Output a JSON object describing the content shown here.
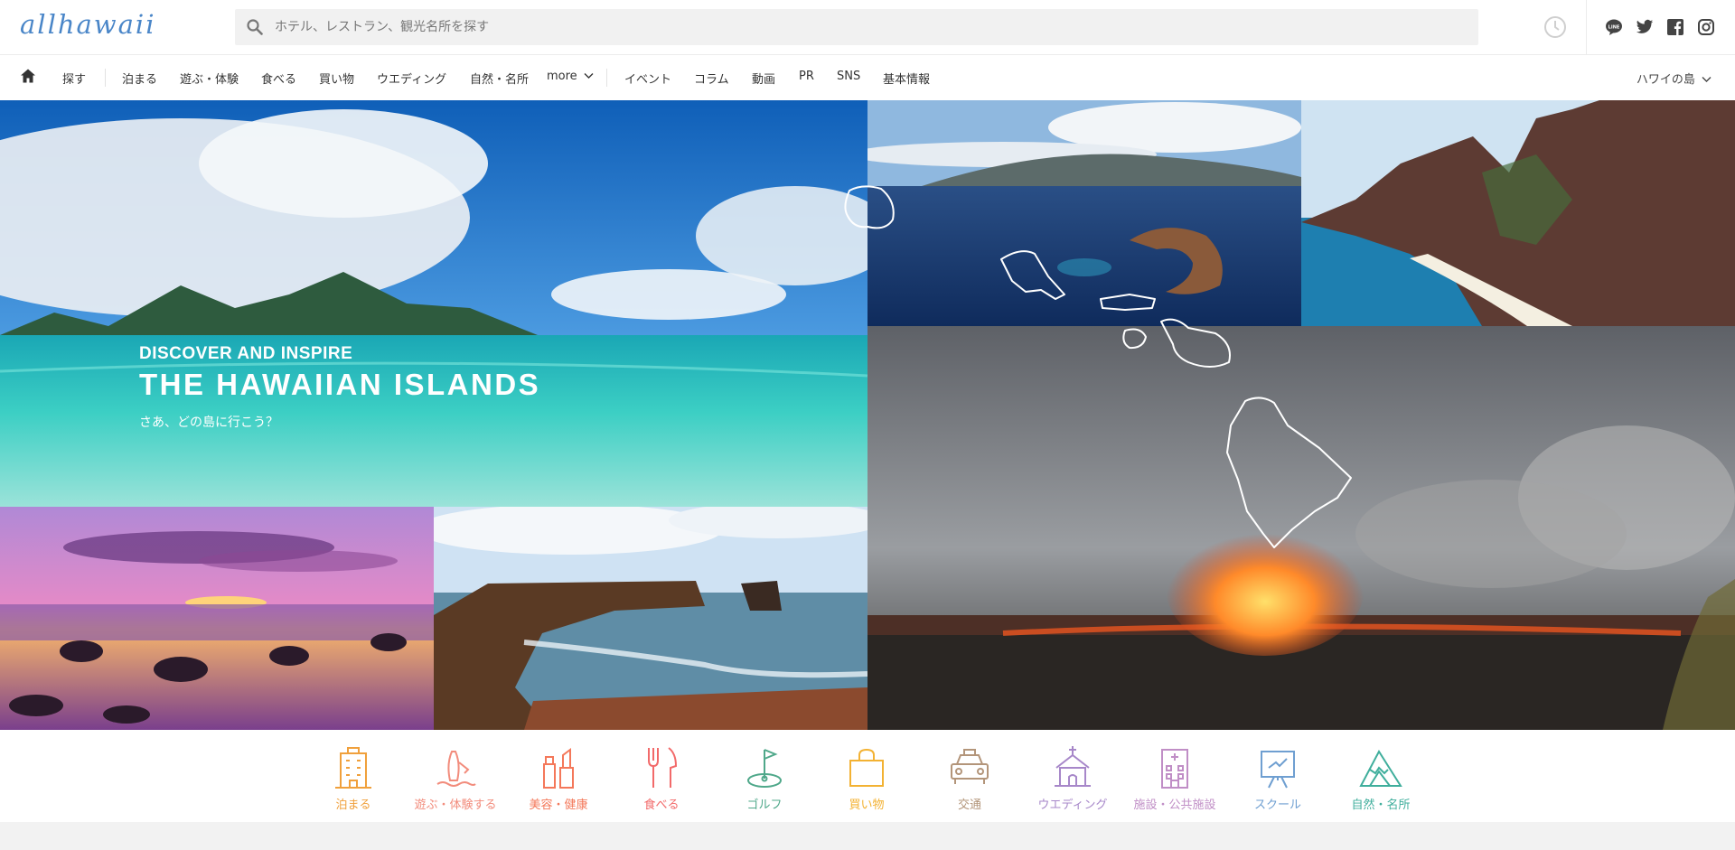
{
  "header": {
    "logo": "allhawaii",
    "search_placeholder": "ホテル、レストラン、観光名所を探す"
  },
  "nav": {
    "items": [
      "探す",
      "泊まる",
      "遊ぶ・体験",
      "食べる",
      "買い物",
      "ウエディング",
      "自然・名所",
      "more",
      "イベント",
      "コラム",
      "動画",
      "PR",
      "SNS",
      "基本情報"
    ],
    "island_select": "ハワイの島"
  },
  "hero": {
    "kicker": "DISCOVER AND INSPIRE",
    "title": "THE HAWAIIAN ISLANDS",
    "subtitle": "さあ、どの島に行こう？"
  },
  "categories": [
    {
      "label": "泊まる",
      "icon": "hotel-icon",
      "color": "#f0a03c"
    },
    {
      "label": "遊ぶ・体験する",
      "icon": "surf-icon",
      "color": "#f28c7c"
    },
    {
      "label": "美容・健康",
      "icon": "beauty-icon",
      "color": "#f4785a"
    },
    {
      "label": "食べる",
      "icon": "fork-knife-icon",
      "color": "#f26a6a"
    },
    {
      "label": "ゴルフ",
      "icon": "golf-icon",
      "color": "#4fa88a"
    },
    {
      "label": "買い物",
      "icon": "shopping-bag-icon",
      "color": "#f3b233"
    },
    {
      "label": "交通",
      "icon": "taxi-icon",
      "color": "#b3957a"
    },
    {
      "label": "ウエディング",
      "icon": "chapel-icon",
      "color": "#a787c9"
    },
    {
      "label": "施設・公共施設",
      "icon": "building-icon",
      "color": "#c08ec6"
    },
    {
      "label": "スクール",
      "icon": "school-icon",
      "color": "#6f9fd1"
    },
    {
      "label": "自然・名所",
      "icon": "mountain-icon",
      "color": "#3fae9c"
    }
  ]
}
